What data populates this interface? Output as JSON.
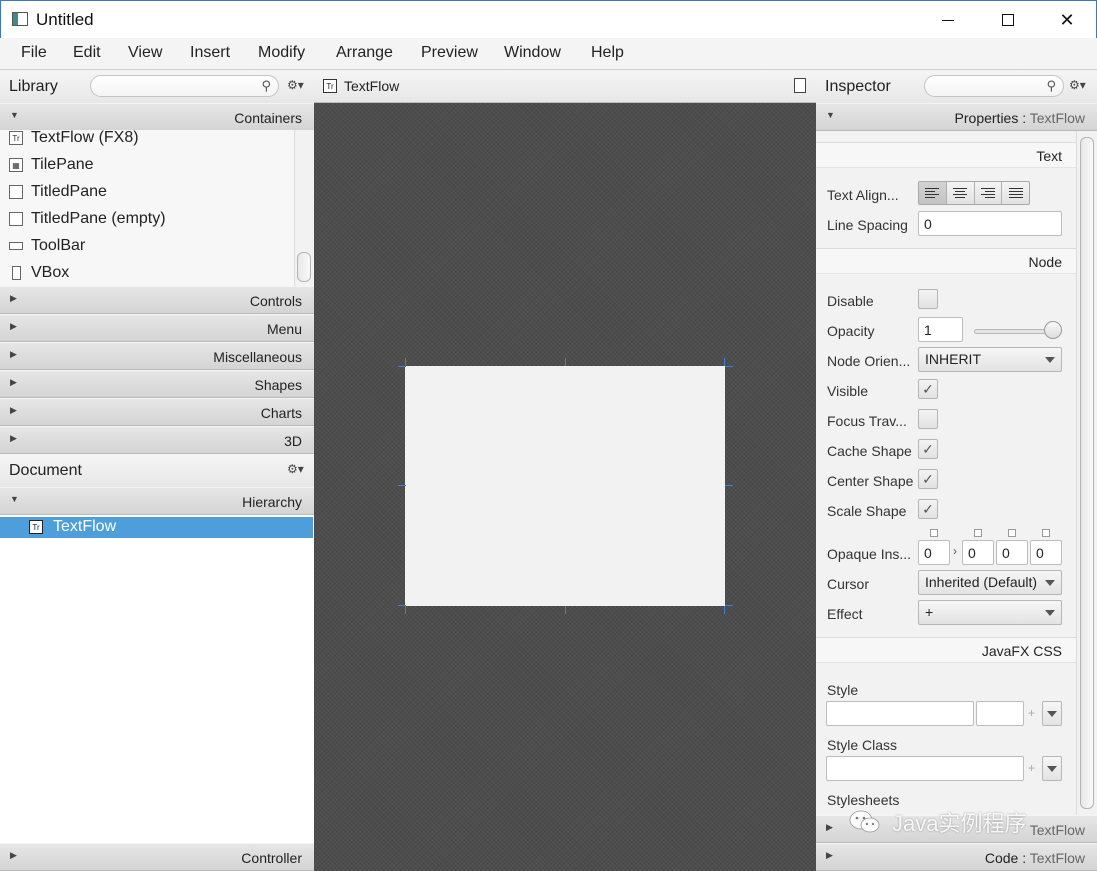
{
  "window": {
    "title": "Untitled",
    "minimize_glyph": "—",
    "maximize_glyph": "☐",
    "close_glyph": "✕"
  },
  "menubar": [
    "File",
    "Edit",
    "View",
    "Insert",
    "Modify",
    "Arrange",
    "Preview",
    "Window",
    "Help"
  ],
  "library": {
    "title": "Library",
    "search_placeholder": "",
    "containers_label": "Containers",
    "items": [
      {
        "label": "TextFlow  (FX8)",
        "icon": "textflow-icon"
      },
      {
        "label": "TilePane",
        "icon": "tilepane-icon"
      },
      {
        "label": "TitledPane",
        "icon": "titledpane-icon"
      },
      {
        "label": "TitledPane  (empty)",
        "icon": "titledpane-icon"
      },
      {
        "label": "ToolBar",
        "icon": "toolbar-icon"
      },
      {
        "label": "VBox",
        "icon": "vbox-icon"
      }
    ],
    "sections": [
      "Controls",
      "Menu",
      "Miscellaneous",
      "Shapes",
      "Charts",
      "3D"
    ]
  },
  "document": {
    "title": "Document",
    "hierarchy_label": "Hierarchy",
    "selected_node": "TextFlow",
    "controller_label": "Controller"
  },
  "center": {
    "tab_label": "TextFlow"
  },
  "inspector": {
    "title": "Inspector",
    "properties_prefix": "Properties",
    "properties_sep": " : ",
    "properties_target": "TextFlow",
    "text_section": "Text",
    "text_alignment_label": "Text Align...",
    "line_spacing_label": "Line Spacing",
    "line_spacing_value": "0",
    "node_section": "Node",
    "disable_label": "Disable",
    "opacity_label": "Opacity",
    "opacity_value": "1",
    "opacity_slider": 1.0,
    "node_orientation_label": "Node Orien...",
    "node_orientation_value": "INHERIT",
    "visible_label": "Visible",
    "focus_traversable_label": "Focus Trav...",
    "cache_shape_label": "Cache Shape",
    "center_shape_label": "Center Shape",
    "scale_shape_label": "Scale Shape",
    "opaque_insets_label": "Opaque Ins...",
    "opaque_insets_values": [
      "0",
      "0",
      "0",
      "0"
    ],
    "opaque_insets_link": "›",
    "cursor_label": "Cursor",
    "cursor_value": "Inherited (Default)",
    "effect_label": "Effect",
    "effect_value": "+",
    "css_section": "JavaFX CSS",
    "style_label": "Style",
    "style_class_label": "Style Class",
    "stylesheets_label": "Stylesheets",
    "plus_glyph": "+",
    "check_glyph": "✓",
    "layout_target": "TextFlow",
    "code_prefix": "Code",
    "code_target": "TextFlow"
  },
  "checkboxes": {
    "disable": false,
    "visible": true,
    "focus_traversable": false,
    "cache_shape": true,
    "center_shape": true,
    "scale_shape": true
  },
  "watermark": "Java实例程序",
  "colors": {
    "selection": "#4e9edb",
    "canvas": "#4d4d4d",
    "handle": "#3d7fd9"
  }
}
